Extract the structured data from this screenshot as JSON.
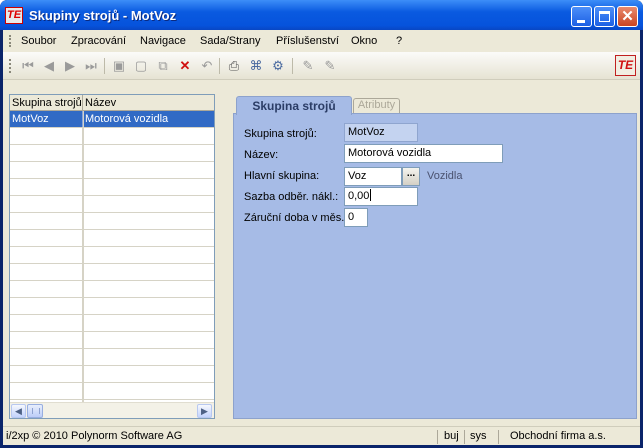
{
  "window": {
    "title": "Skupiny strojů - MotVoz",
    "app_icon_text": "TE"
  },
  "menu": [
    "Soubor",
    "Zpracování",
    "Navigace",
    "Sada/Strany",
    "Příslušenství",
    "Okno",
    "?"
  ],
  "toolbar": {
    "buttons": [
      {
        "name": "first-record-icon",
        "glyph": "⏮"
      },
      {
        "name": "previous-record-icon",
        "glyph": "◀"
      },
      {
        "name": "next-record-icon",
        "glyph": "▶"
      },
      {
        "name": "last-record-icon",
        "glyph": "⏭"
      },
      {
        "name": "save-icon",
        "glyph": "▣"
      },
      {
        "name": "new-record-icon",
        "glyph": "▢"
      },
      {
        "name": "copy-icon",
        "glyph": "⧉"
      },
      {
        "name": "delete-icon",
        "glyph": "✕"
      },
      {
        "name": "undo-icon",
        "glyph": "↶"
      },
      {
        "name": "print-icon",
        "glyph": "⎙"
      },
      {
        "name": "tree-icon",
        "glyph": "⌘"
      },
      {
        "name": "settings-icon",
        "glyph": "⚙"
      },
      {
        "name": "edit-pen-icon",
        "glyph": "✎"
      },
      {
        "name": "edit-pen-alt-icon",
        "glyph": "✎"
      }
    ],
    "brand_text": "TE"
  },
  "grid": {
    "columns": [
      "Skupina strojů",
      "Název"
    ],
    "rows": [
      [
        "MotVoz",
        "Motorová vozidla"
      ],
      [
        "",
        ""
      ],
      [
        "",
        ""
      ],
      [
        "",
        ""
      ],
      [
        "",
        ""
      ],
      [
        "",
        ""
      ],
      [
        "",
        ""
      ],
      [
        "",
        ""
      ],
      [
        "",
        ""
      ],
      [
        "",
        ""
      ],
      [
        "",
        ""
      ],
      [
        "",
        ""
      ],
      [
        "",
        ""
      ],
      [
        "",
        ""
      ],
      [
        "",
        ""
      ],
      [
        "",
        ""
      ],
      [
        "",
        ""
      ],
      [
        "",
        ""
      ]
    ],
    "selected_row": 0
  },
  "tabs": {
    "active": "Skupina strojů",
    "inactive": "Atributy"
  },
  "form": {
    "group_label": "Skupina strojů:",
    "group_value": "MotVoz",
    "name_label": "Název:",
    "name_value": "Motorová vozidla",
    "main_group_label": "Hlavní skupina:",
    "main_group_value": "Voz",
    "main_group_lookup": "...",
    "main_group_desc": "Vozidla",
    "rate_label": "Sazba odběr. nákl.:",
    "rate_value": "0,00",
    "warranty_label": "Záruční doba v měs.:",
    "warranty_value": "0"
  },
  "status": {
    "copyright": "i/2xp © 2010 Polynorm Software AG",
    "user1": "buj",
    "user2": "sys",
    "company": "Obchodní firma a.s."
  }
}
